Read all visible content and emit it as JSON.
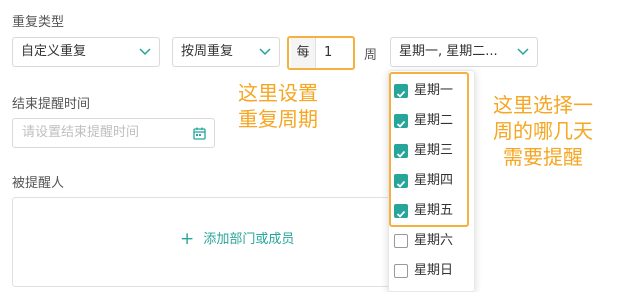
{
  "repeat_type": {
    "label": "重复类型",
    "custom_select": "自定义重复",
    "unit_select": "按周重复",
    "every_prefix": "每",
    "interval_value": "1",
    "week_suffix": "周",
    "days_select": "星期一, 星期二..."
  },
  "annotations": {
    "setting_note_line1": "这里设置",
    "setting_note_line2": "重复周期",
    "days_note_line1": "这里选择一",
    "days_note_line2": "周的哪几天",
    "days_note_line3": "需要提醒"
  },
  "end_time": {
    "label": "结束提醒时间",
    "placeholder": "请设置结束提醒时间"
  },
  "reminded": {
    "label": "被提醒人",
    "add_label": "添加部门或成员"
  },
  "weekday_options": [
    {
      "label": "星期一",
      "checked": true
    },
    {
      "label": "星期二",
      "checked": true
    },
    {
      "label": "星期三",
      "checked": true
    },
    {
      "label": "星期四",
      "checked": true
    },
    {
      "label": "星期五",
      "checked": true
    },
    {
      "label": "星期六",
      "checked": false
    },
    {
      "label": "星期日",
      "checked": false
    }
  ],
  "colors": {
    "accent": "#26a69a",
    "annotation": "#f5a623"
  }
}
